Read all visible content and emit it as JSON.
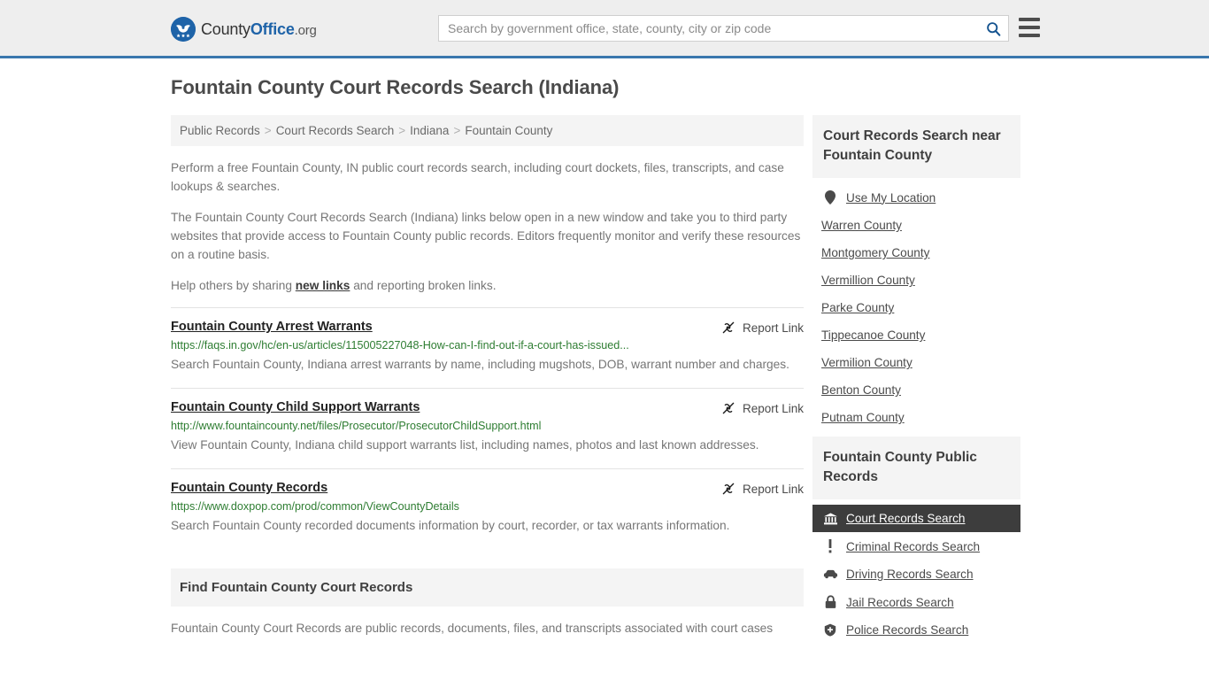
{
  "header": {
    "logo": {
      "icon": "eagle-shield-icon",
      "text_part1": "County",
      "text_part2": "Office",
      "text_part3": ".org"
    },
    "search": {
      "placeholder": "Search by government office, state, county, city or zip code",
      "value": "",
      "search_icon": "search-icon"
    },
    "menu_icon": "hamburger-menu-icon",
    "accent_color": "#3a77ad",
    "background_color": "#eeeeee"
  },
  "page": {
    "title": "Fountain County Court Records Search (Indiana)"
  },
  "breadcrumb": {
    "separator": ">",
    "items": [
      {
        "label": "Public Records"
      },
      {
        "label": "Court Records Search"
      },
      {
        "label": "Indiana"
      },
      {
        "label": "Fountain County"
      }
    ]
  },
  "intro": {
    "paragraph1": "Perform a free Fountain County, IN public court records search, including court dockets, files, transcripts, and case lookups & searches.",
    "paragraph2": "The Fountain County Court Records Search (Indiana) links below open in a new window and take you to third party websites that provide access to Fountain County public records. Editors frequently monitor and verify these resources on a routine basis.",
    "paragraph3_before": "Help others by sharing ",
    "paragraph3_link": "new links",
    "paragraph3_after": " and reporting broken links."
  },
  "report_link_label": "Report Link",
  "report_link_icon": "broken-link-icon",
  "results": [
    {
      "title": "Fountain County Arrest Warrants",
      "url": "https://faqs.in.gov/hc/en-us/articles/115005227048-How-can-I-find-out-if-a-court-has-issued...",
      "description": "Search Fountain County, Indiana arrest warrants by name, including mugshots, DOB, warrant number and charges."
    },
    {
      "title": "Fountain County Child Support Warrants",
      "url": "http://www.fountaincounty.net/files/Prosecutor/ProsecutorChildSupport.html",
      "description": "View Fountain County, Indiana child support warrants list, including names, photos and last known addresses."
    },
    {
      "title": "Fountain County Records",
      "url": "https://www.doxpop.com/prod/common/ViewCountyDetails",
      "description": "Search Fountain County recorded documents information by court, recorder, or tax warrants information."
    }
  ],
  "find_section": {
    "heading": "Find Fountain County Court Records",
    "body": "Fountain County Court Records are public records, documents, files, and transcripts associated with court cases"
  },
  "sidebar": {
    "nearby": {
      "heading": "Court Records Search near Fountain County",
      "items": [
        {
          "label": "Use My Location",
          "icon": "map-pin-icon",
          "has_icon": true
        },
        {
          "label": "Warren County",
          "icon": "",
          "has_icon": false
        },
        {
          "label": "Montgomery County",
          "icon": "",
          "has_icon": false
        },
        {
          "label": "Vermillion County",
          "icon": "",
          "has_icon": false
        },
        {
          "label": "Parke County",
          "icon": "",
          "has_icon": false
        },
        {
          "label": "Tippecanoe County",
          "icon": "",
          "has_icon": false
        },
        {
          "label": "Vermilion County",
          "icon": "",
          "has_icon": false
        },
        {
          "label": "Benton County",
          "icon": "",
          "has_icon": false
        },
        {
          "label": "Putnam County",
          "icon": "",
          "has_icon": false
        }
      ]
    },
    "public_records": {
      "heading": "Fountain County Public Records",
      "active_index": 0,
      "items": [
        {
          "label": "Court Records Search",
          "icon": "courthouse-icon",
          "active": true
        },
        {
          "label": "Criminal Records Search",
          "icon": "exclamation-icon",
          "active": false
        },
        {
          "label": "Driving Records Search",
          "icon": "car-icon",
          "active": false
        },
        {
          "label": "Jail Records Search",
          "icon": "lock-icon",
          "active": false
        },
        {
          "label": "Police Records Search",
          "icon": "police-badge-icon",
          "active": false
        }
      ]
    }
  }
}
